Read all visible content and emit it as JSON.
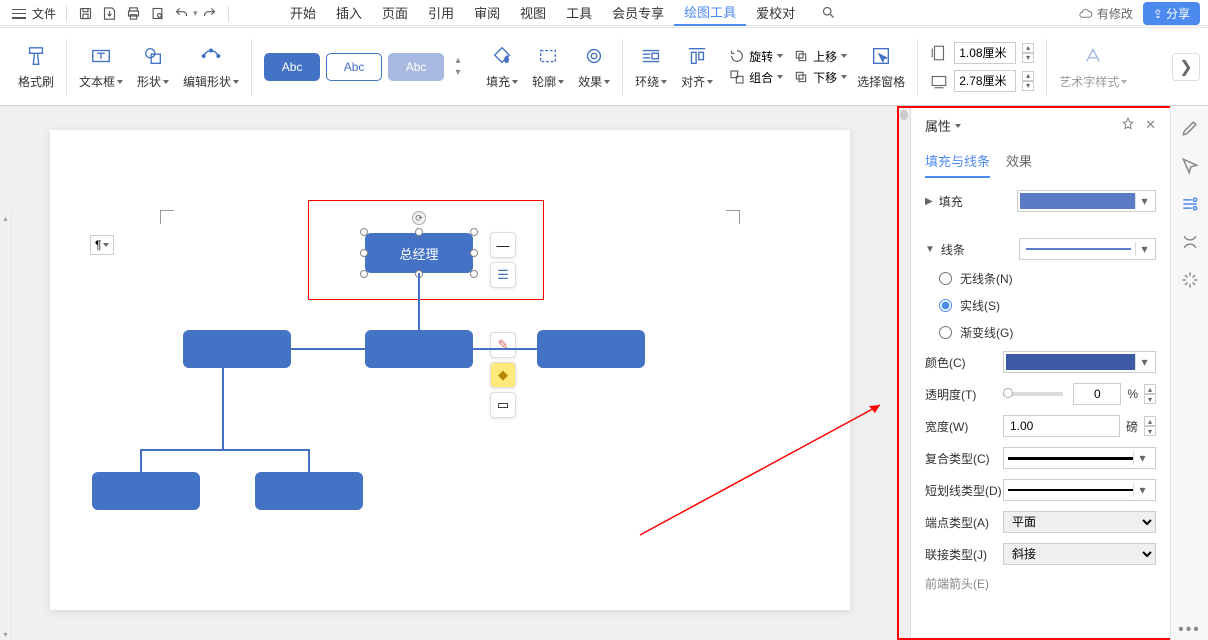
{
  "titlebar": {
    "file": "文件",
    "cloud": "有修改",
    "share": "分享"
  },
  "tabs": {
    "items": [
      "开始",
      "插入",
      "页面",
      "引用",
      "审阅",
      "视图",
      "工具",
      "会员专享",
      "绘图工具",
      "爱校对"
    ],
    "active_index": 8
  },
  "ribbon": {
    "format_painter": "格式刷",
    "textbox": "文本框",
    "shape": "形状",
    "edit_shape": "编辑形状",
    "pill_label": "Abc",
    "fill": "填充",
    "outline": "轮廓",
    "effect": "效果",
    "wrap": "环绕",
    "align": "对齐",
    "rotate": "旋转",
    "group": "组合",
    "up": "上移",
    "down": "下移",
    "select_pane": "选择窗格",
    "height": "1.08厘米",
    "width": "2.78厘米",
    "wordart": "艺术字样式"
  },
  "canvas": {
    "selected_text": "总经理",
    "para_icon": "¶"
  },
  "float": {
    "minus": "—",
    "lines": "☰",
    "pencil": "✎",
    "bucket": "◆",
    "rect": "▭"
  },
  "panel": {
    "title": "属性",
    "tab_fill": "填充与线条",
    "tab_effect": "效果",
    "section_fill": "填充",
    "section_line": "线条",
    "opt_none": "无线条(N)",
    "opt_solid": "实线(S)",
    "opt_gradient": "渐变线(G)",
    "color": "颜色(C)",
    "opacity": "透明度(T)",
    "opacity_val": "0",
    "opacity_unit": "%",
    "width_l": "宽度(W)",
    "width_val": "1.00",
    "width_unit": "磅",
    "compound": "复合类型(C)",
    "dash": "短划线类型(D)",
    "cap": "端点类型(A)",
    "cap_val": "平面",
    "join": "联接类型(J)",
    "join_val": "斜接",
    "arrow_start": "前端箭头(E)"
  }
}
